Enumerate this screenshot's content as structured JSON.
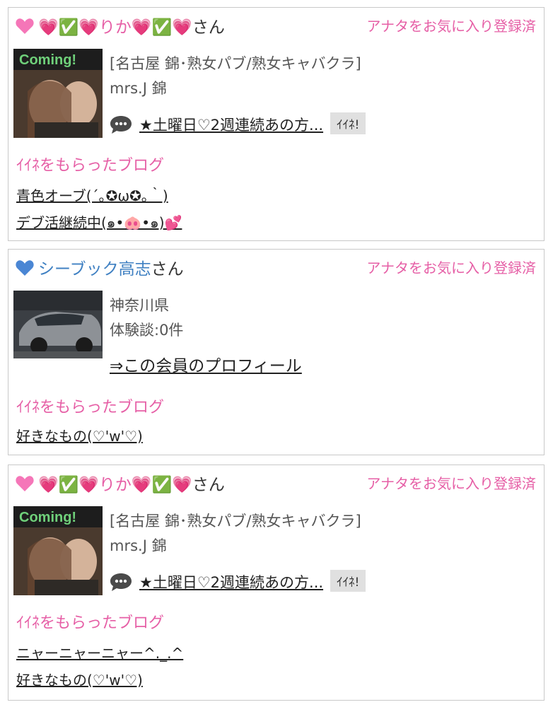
{
  "cards": [
    {
      "name_prefix": "💗✅💗りか💗✅💗",
      "name_suffix": "さん",
      "favorite_status": "アナタをお気に入り登録済",
      "shop_location": "[名古屋 錦･熟女パブ/熟女キャバクラ]",
      "shop_name": "mrs.J 錦",
      "blog_title": "★土曜日♡2週連続あの方...",
      "like_button": "ｲｲﾈ!",
      "liked_section_label": "ｲｲﾈをもらったブログ",
      "liked_blogs": [
        "青色オーブ(´｡✪ω✪｡｀)",
        "デブ活継続中(๑•🐽•๑)💕"
      ]
    },
    {
      "name": "シーブック高志",
      "name_suffix": "さん",
      "favorite_status": "アナタをお気に入り登録済",
      "region": "神奈川県",
      "review_count": "体験談:0件",
      "profile_link": "⇒この会員のプロフィール",
      "liked_section_label": "ｲｲﾈをもらったブログ",
      "liked_blogs": [
        "好きなもの(♡'w'♡)"
      ]
    },
    {
      "name_prefix": "💗✅💗りか💗✅💗",
      "name_suffix": "さん",
      "favorite_status": "アナタをお気に入り登録済",
      "shop_location": "[名古屋 錦･熟女パブ/熟女キャバクラ]",
      "shop_name": "mrs.J 錦",
      "blog_title": "★土曜日♡2週連続あの方...",
      "like_button": "ｲｲﾈ!",
      "liked_section_label": "ｲｲﾈをもらったブログ",
      "liked_blogs": [
        "ニャーニャーニャー^._.^",
        "好きなもの(♡'w'♡)"
      ]
    }
  ],
  "colors": {
    "pink": "#e65fa6",
    "blue": "#3f80c2",
    "border": "#c9c9c9"
  },
  "icons": {
    "heart_pink": "pink-heart-icon",
    "heart_blue": "blue-heart-icon",
    "bubble": "speech-bubble-icon"
  }
}
